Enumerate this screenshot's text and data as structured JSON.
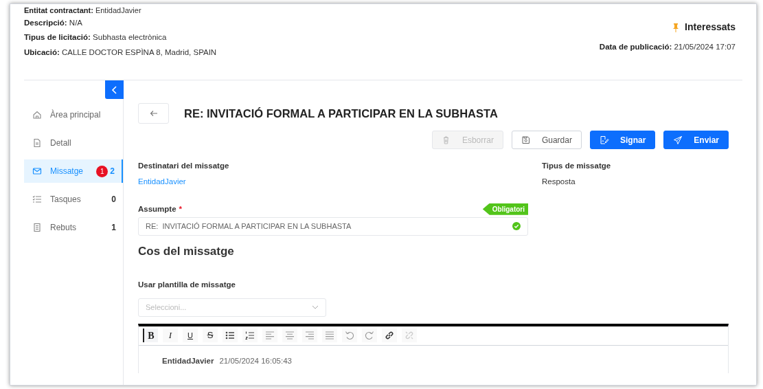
{
  "header": {
    "fields": [
      {
        "label": "Entitat contractant:",
        "value": "EntidadJavier"
      },
      {
        "label": "Descripció:",
        "value": "N/A"
      },
      {
        "label": "Tipus de licitació:",
        "value": "Subhasta electrònica"
      },
      {
        "label": "Ubicació:",
        "value": "CALLE DOCTOR ESPÌNA 8, Madrid, SPAIN"
      }
    ],
    "interested_link": "Interessats",
    "publication": {
      "label": "Data de publicació:",
      "value": "21/05/2024 17:07"
    }
  },
  "sidebar": {
    "items": [
      {
        "kind": "home",
        "label": "Àrea principal",
        "selected": false
      },
      {
        "kind": "document",
        "label": "Detall",
        "selected": false
      },
      {
        "kind": "mail",
        "label": "Missatge",
        "selected": true,
        "badge": "1",
        "count": "2"
      },
      {
        "kind": "tasks",
        "label": "Tasques",
        "selected": false,
        "count": "0"
      },
      {
        "kind": "receipt",
        "label": "Rebuts",
        "selected": false,
        "count": "1"
      }
    ]
  },
  "message": {
    "title": "RE: INVITACIÓ FORMAL A PARTICIPAR EN LA SUBHASTA",
    "actions": [
      {
        "kind": "delete",
        "label": "Esborrar",
        "disabled": true,
        "primary": false
      },
      {
        "kind": "save",
        "label": "Guardar",
        "disabled": false,
        "primary": false
      },
      {
        "kind": "sign",
        "label": "Signar",
        "disabled": false,
        "primary": true
      },
      {
        "kind": "send",
        "label": "Enviar",
        "disabled": false,
        "primary": true
      }
    ],
    "recipient": {
      "label": "Destinatari del missatge",
      "value": "EntidadJavier"
    },
    "message_type": {
      "label": "Tipus de missatge",
      "value": "Resposta"
    },
    "subject": {
      "label": "Assumpte",
      "required_mark": "*",
      "tag": "Obligatori",
      "value": "RE:  INVITACIÓ FORMAL A PARTICIPAR EN LA SUBHASTA",
      "valid": true
    },
    "body_heading": "Cos del missatge",
    "template": {
      "label": "Usar plantilla de missatge",
      "placeholder": "Seleccioni..."
    },
    "editor": {
      "tools": [
        {
          "kind": "bold",
          "label": "B",
          "active": true
        },
        {
          "kind": "italic",
          "label": "I",
          "active": false
        },
        {
          "kind": "underline",
          "label": "U",
          "active": false
        },
        {
          "kind": "strike",
          "label": "S",
          "active": false
        },
        {
          "kind": "bullet-list",
          "active": false
        },
        {
          "kind": "number-list",
          "active": false
        },
        {
          "kind": "align-left",
          "active": false
        },
        {
          "kind": "align-center",
          "active": false
        },
        {
          "kind": "align-right",
          "active": false
        },
        {
          "kind": "justify",
          "active": false
        },
        {
          "kind": "undo",
          "active": false
        },
        {
          "kind": "redo",
          "active": false
        },
        {
          "kind": "link",
          "active": false
        },
        {
          "kind": "unlink",
          "active": false,
          "disabled": true
        }
      ],
      "author": "EntidadJavier",
      "timestamp": "21/05/2024 16:05:43"
    }
  }
}
